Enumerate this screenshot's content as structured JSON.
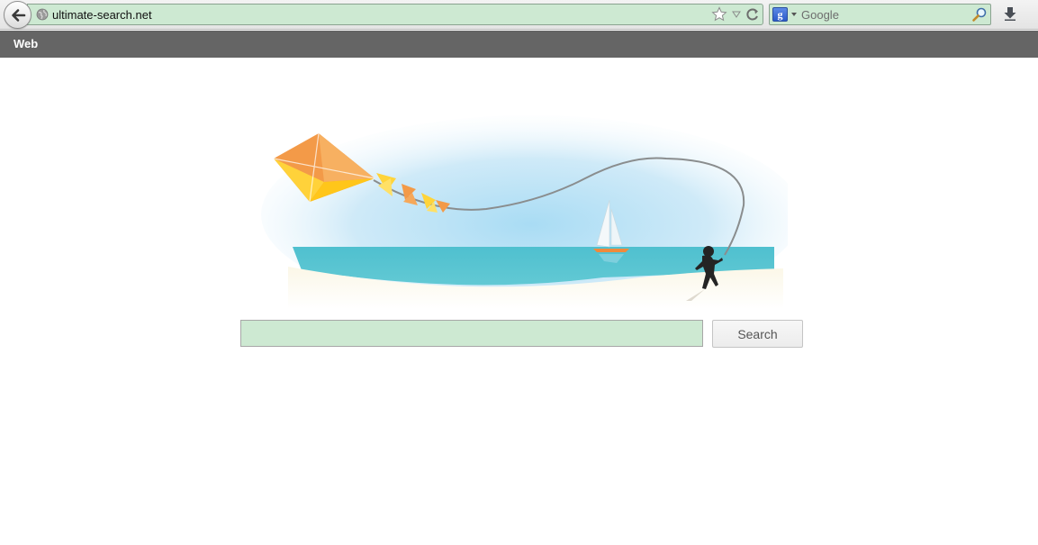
{
  "browser": {
    "url": "ultimate-search.net",
    "search_engine": "Google",
    "search_placeholder": "Google",
    "engine_letter": "g"
  },
  "icons": {
    "back": "back-arrow-icon",
    "site": "globe-icon",
    "bookmark": "star-icon",
    "history": "chevron-down-icon",
    "reload": "reload-icon",
    "engine": "google-icon",
    "search": "magnifier-icon",
    "downloads": "download-arrow-icon"
  },
  "nav": {
    "web_label": "Web"
  },
  "search": {
    "query": "",
    "button_label": "Search"
  },
  "colors": {
    "field_background": "#cde9d2",
    "nav_background": "#656565",
    "sea": "#54c2d0",
    "kite_orange": "#f39a48",
    "kite_yellow": "#ffcc1a"
  }
}
